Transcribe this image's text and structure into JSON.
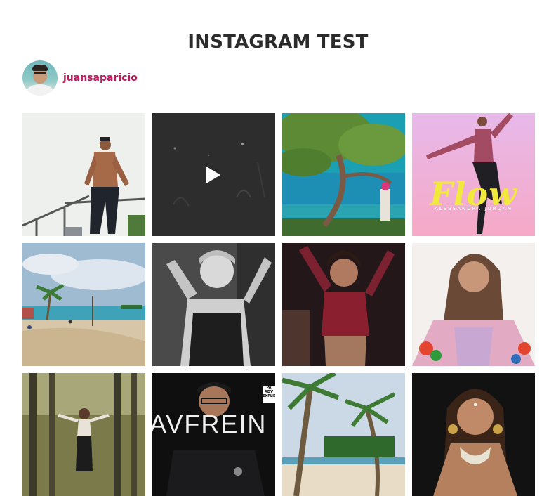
{
  "header": {
    "title": "INSTAGRAM TEST"
  },
  "profile": {
    "username": "juansaparicio"
  },
  "colors": {
    "username": "#c2185b",
    "title": "#2b2b2b"
  },
  "posts": [
    {
      "subject": "shirtless man on railing",
      "type": "image"
    },
    {
      "subject": "dark night video",
      "type": "video",
      "icon": "play-icon"
    },
    {
      "subject": "tree over ocean",
      "type": "image"
    },
    {
      "subject": "dancer album cover",
      "type": "image",
      "cover_title": "Flow",
      "cover_subtitle": "ALESSANDRA JORDAN"
    },
    {
      "subject": "beach with palms",
      "type": "image"
    },
    {
      "subject": "black and white portrait",
      "type": "image"
    },
    {
      "subject": "woman in red lace top",
      "type": "image"
    },
    {
      "subject": "woman in floral outfit",
      "type": "image"
    },
    {
      "subject": "woman in forest",
      "type": "image"
    },
    {
      "subject": "man album cover",
      "type": "image",
      "cover_title": "AVFREIN",
      "badge": "PA ADV EXPLIC"
    },
    {
      "subject": "palm trees on beach",
      "type": "image"
    },
    {
      "subject": "woman with gold jewelry",
      "type": "image"
    }
  ]
}
